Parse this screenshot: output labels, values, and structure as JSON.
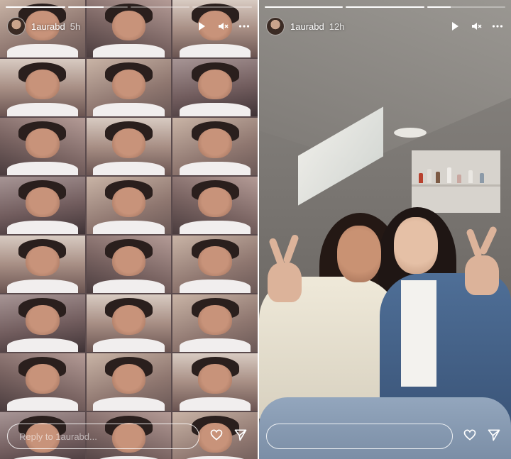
{
  "stories": [
    {
      "username": "1aurabd",
      "time": "5h",
      "progress": [
        1,
        0.6,
        0,
        0
      ],
      "reply_placeholder": "Reply to 1aurabd..."
    },
    {
      "username": "1aurabd",
      "time": "12h",
      "progress": [
        1,
        1,
        0.3
      ],
      "reply_placeholder": ""
    }
  ],
  "icons": {
    "play": "play-icon",
    "mute": "mute-icon",
    "more": "more-icon",
    "like": "heart-icon",
    "share": "send-icon"
  },
  "colors": {
    "overlay_text": "#ffffff"
  }
}
